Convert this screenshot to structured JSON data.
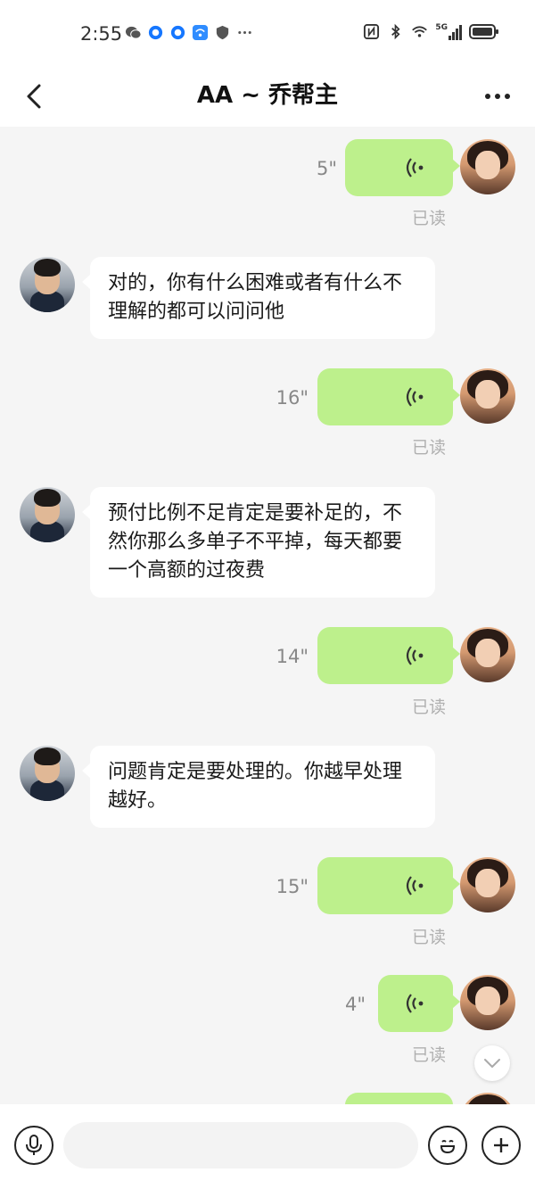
{
  "status_bar": {
    "time": "2:55",
    "left_icons": [
      "wechat-icon",
      "browser-icon",
      "browser-icon",
      "wifi-app-icon",
      "shield-icon",
      "more-dots-icon"
    ],
    "right_icons": [
      "nfc-icon",
      "bluetooth-icon",
      "wifi-icon",
      "signal-5g-icon",
      "battery-icon"
    ],
    "network_label": "5G"
  },
  "header": {
    "title": "AA ~ 乔帮主",
    "back_icon": "chevron-left-icon",
    "more_icon": "more-dots-icon"
  },
  "messages": [
    {
      "type": "voice",
      "sender": "me",
      "duration": "5\"",
      "read_status": "已读"
    },
    {
      "type": "text",
      "sender": "contact",
      "text": "对的，你有什么困难或者有什么不理解的都可以问问他"
    },
    {
      "type": "voice",
      "sender": "me",
      "duration": "16\"",
      "read_status": "已读"
    },
    {
      "type": "text",
      "sender": "contact",
      "text": "预付比例不足肯定是要补足的，不然你那么多单子不平掉，每天都要一个高额的过夜费"
    },
    {
      "type": "voice",
      "sender": "me",
      "duration": "14\"",
      "read_status": "已读"
    },
    {
      "type": "text",
      "sender": "contact",
      "text": "问题肯定是要处理的。你越早处理越好。"
    },
    {
      "type": "voice",
      "sender": "me",
      "duration": "15\"",
      "read_status": "已读"
    },
    {
      "type": "voice",
      "sender": "me",
      "duration": "4\"",
      "read_status": "已读"
    }
  ],
  "input_bar": {
    "voice_icon": "microphone-icon",
    "emoji_icon": "emoji-icon",
    "plus_icon": "plus-icon",
    "placeholder": ""
  },
  "colors": {
    "my_bubble": "#bdf08c",
    "their_bubble": "#ffffff",
    "background": "#f5f5f5",
    "read_text": "#b0b0b0"
  }
}
